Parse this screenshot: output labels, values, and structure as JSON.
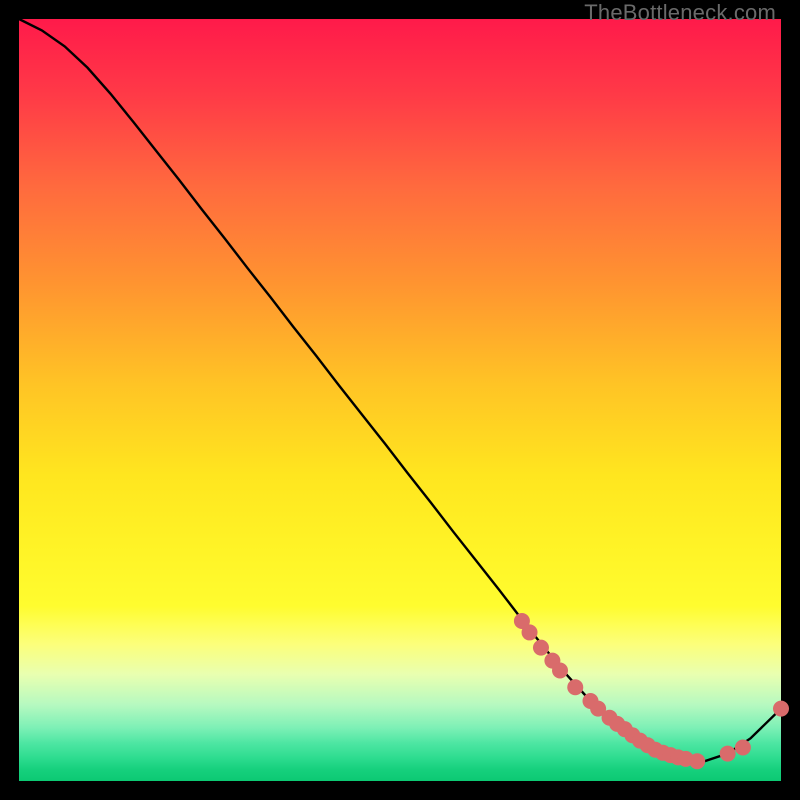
{
  "attribution": "TheBottleneck.com",
  "chart_data": {
    "type": "line",
    "title": "",
    "xlabel": "",
    "ylabel": "",
    "xlim": [
      0,
      100
    ],
    "ylim": [
      0,
      100
    ],
    "series": [
      {
        "name": "curve",
        "x": [
          0,
          3,
          6,
          9,
          12,
          15,
          18,
          21,
          24,
          27,
          30,
          33,
          36,
          39,
          42,
          45,
          48,
          51,
          54,
          57,
          60,
          63,
          66,
          69,
          72,
          75,
          78,
          81,
          84,
          87,
          90,
          93,
          96,
          100
        ],
        "y": [
          100,
          98.5,
          96.4,
          93.6,
          90.2,
          86.5,
          82.7,
          78.9,
          75.0,
          71.2,
          67.3,
          63.5,
          59.6,
          55.8,
          51.9,
          48.1,
          44.3,
          40.4,
          36.6,
          32.7,
          28.9,
          25.1,
          21.2,
          17.4,
          13.8,
          10.5,
          7.7,
          5.3,
          3.6,
          2.6,
          2.6,
          3.6,
          5.6,
          9.5
        ]
      }
    ],
    "markers": {
      "name": "highlighted-points",
      "color": "#d96b6b",
      "x": [
        66,
        67,
        68.5,
        70,
        71,
        73,
        75,
        76,
        77.5,
        78.5,
        79.5,
        80.5,
        81.5,
        82.5,
        83.5,
        84.5,
        85.5,
        86.5,
        87.5,
        89,
        93,
        95,
        100
      ],
      "y": [
        21.0,
        19.5,
        17.5,
        15.8,
        14.5,
        12.3,
        10.5,
        9.5,
        8.3,
        7.5,
        6.8,
        6.0,
        5.3,
        4.7,
        4.1,
        3.7,
        3.4,
        3.1,
        2.9,
        2.6,
        3.6,
        4.4,
        9.5
      ]
    }
  }
}
